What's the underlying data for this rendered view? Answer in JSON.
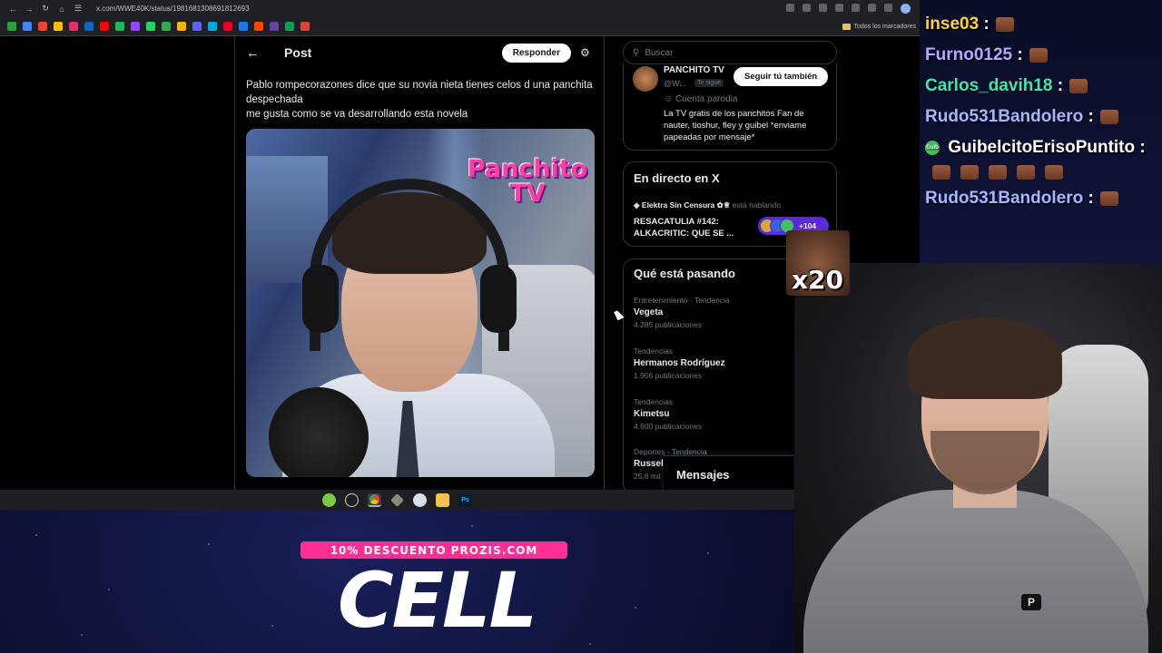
{
  "browser": {
    "address": "x.com/WWE40K/status/1981681308691812693",
    "bookmarks_folder": "Todos los marcadores",
    "favicons": [
      "#2aa33b",
      "#4285f4",
      "#ea4335",
      "#fbbc05",
      "#e1306c",
      "#0a66c2",
      "#ff0000",
      "#1db954",
      "#9146ff",
      "#25d366",
      "#34a853",
      "#f4b400",
      "#5865f2",
      "#00a8e1",
      "#e60023",
      "#1877f2",
      "#ff4500",
      "#6441a5",
      "#0f9d58",
      "#db4437"
    ]
  },
  "post": {
    "header_title": "Post",
    "reply_label": "Responder",
    "text_line1": "Pablo rompecorazones dice que su novia nieta tienes celos d una panchita despechada",
    "text_line2": "me gusta como se va desarrollando esta novela",
    "video_logo_line1": "Panchito",
    "video_logo_line2": "TV"
  },
  "sidebar": {
    "search_placeholder": "Buscar",
    "profile": {
      "name": "PANCHITO TV",
      "handle": "@W...",
      "follows_you": "Te sigue",
      "follow_button": "Seguir tú también",
      "parody_label": "Cuenta parodia",
      "bio": "La TV gratis de los panchitos Fan de nauter, tioshur, fley y guibel *enviame papeadas por mensaje*"
    },
    "live": {
      "title": "En directo en X",
      "host": "Elektra Sin Censura",
      "host_status": "está hablando",
      "topic": "RESACATULIA #142: ALKACRITIC:  QUE SE ...",
      "listeners": "+104"
    },
    "trends_title": "Qué está pasando",
    "trends": [
      {
        "category": "Entretenimiento · Tendencia",
        "name": "Vegeta",
        "count": "4.285 publicaciones"
      },
      {
        "category": "Tendencias",
        "name": "Hermanos Rodríguez",
        "count": "1.906 publicaciones"
      },
      {
        "category": "Tendencias",
        "name": "Kimetsu",
        "count": "4.600 publicaciones"
      },
      {
        "category": "Deportes · Tendencia",
        "name": "Russell",
        "count": "25,6 mil"
      }
    ],
    "messages_label": "Mensajes"
  },
  "taskbar": {
    "apps": [
      "app-green-icon",
      "clock-icon",
      "chrome-icon",
      "tool-icon",
      "globe-icon",
      "folder-icon",
      "photoshop-icon"
    ],
    "photoshop_label": "Ps"
  },
  "chat": {
    "messages": [
      {
        "user": "inse03",
        "color": "#ffd23c"
      },
      {
        "user": "Furno0125",
        "color": "#b9a8ff"
      },
      {
        "user": "Carlos_davih18",
        "color": "#3fe6b4"
      },
      {
        "user": "Rudo531Bandolero",
        "color": "#a7b6ff"
      },
      {
        "user": "GuibelcitoErisoPuntito",
        "color": "#ffffff"
      },
      {
        "user": "Rudo531Bandolero",
        "color": "#a7b6ff"
      }
    ],
    "separator": ":",
    "live_badge": "Guib"
  },
  "overlay": {
    "emote_multiplier": "x20",
    "promo_tag": "10% DESCUENTO PROZIS.COM",
    "promo_title": "CELL"
  }
}
